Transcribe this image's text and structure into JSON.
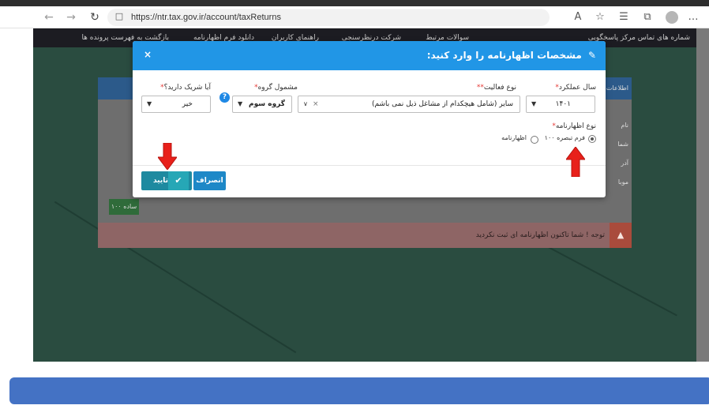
{
  "browser": {
    "url": "https://ntr.tax.gov.ir/account/taxReturns"
  },
  "site_nav": {
    "items": [
      "شماره های تماس مرکز پاسخگویی",
      "سوالات مرتبط",
      "شرکت درنظرسنجی",
      "راهنمای کاربران",
      "دانلود فرم اظهارنامه",
      "بازگشت به فهرست پرونده ها"
    ]
  },
  "background": {
    "card_title": "اطلاعات",
    "labels": [
      "نام",
      "شما",
      "آدر",
      "موبا"
    ],
    "green_button": "ساده ۱۰۰",
    "alert_text": "توجه ! شما تاکنون اظهارنامه ای ثبت نکردید"
  },
  "modal": {
    "title": "مشخصات اظهارنامه را وارد کنید:",
    "close": "×",
    "fields": {
      "year_label": "سال عملکرد",
      "year_value": "۱۴۰۱",
      "activity_label": "نوع فعالیت",
      "activity_value": "سایر (شامل هیچکدام از مشاغل ذیل نمی باشم)",
      "group_label": "مشمول گروه",
      "group_value": "گروه سوم",
      "partner_label": "آیا شریک دارید؟",
      "partner_value": "خیر",
      "return_type_label": "نوع اظهارنامه",
      "required_mark": "*"
    },
    "return_types": [
      {
        "label": "فرم تبصره ۱۰۰",
        "selected": true
      },
      {
        "label": "اظهارنامه",
        "selected": false
      }
    ],
    "buttons": {
      "confirm": "تایید",
      "cancel": "انصراف"
    }
  },
  "colors": {
    "modal_header": "#2196e6",
    "confirm_button": "#1e8aa0",
    "cancel_button": "#1e88c7",
    "annotation_arrow": "#e8201a",
    "bottom_bar": "#4472c4"
  }
}
